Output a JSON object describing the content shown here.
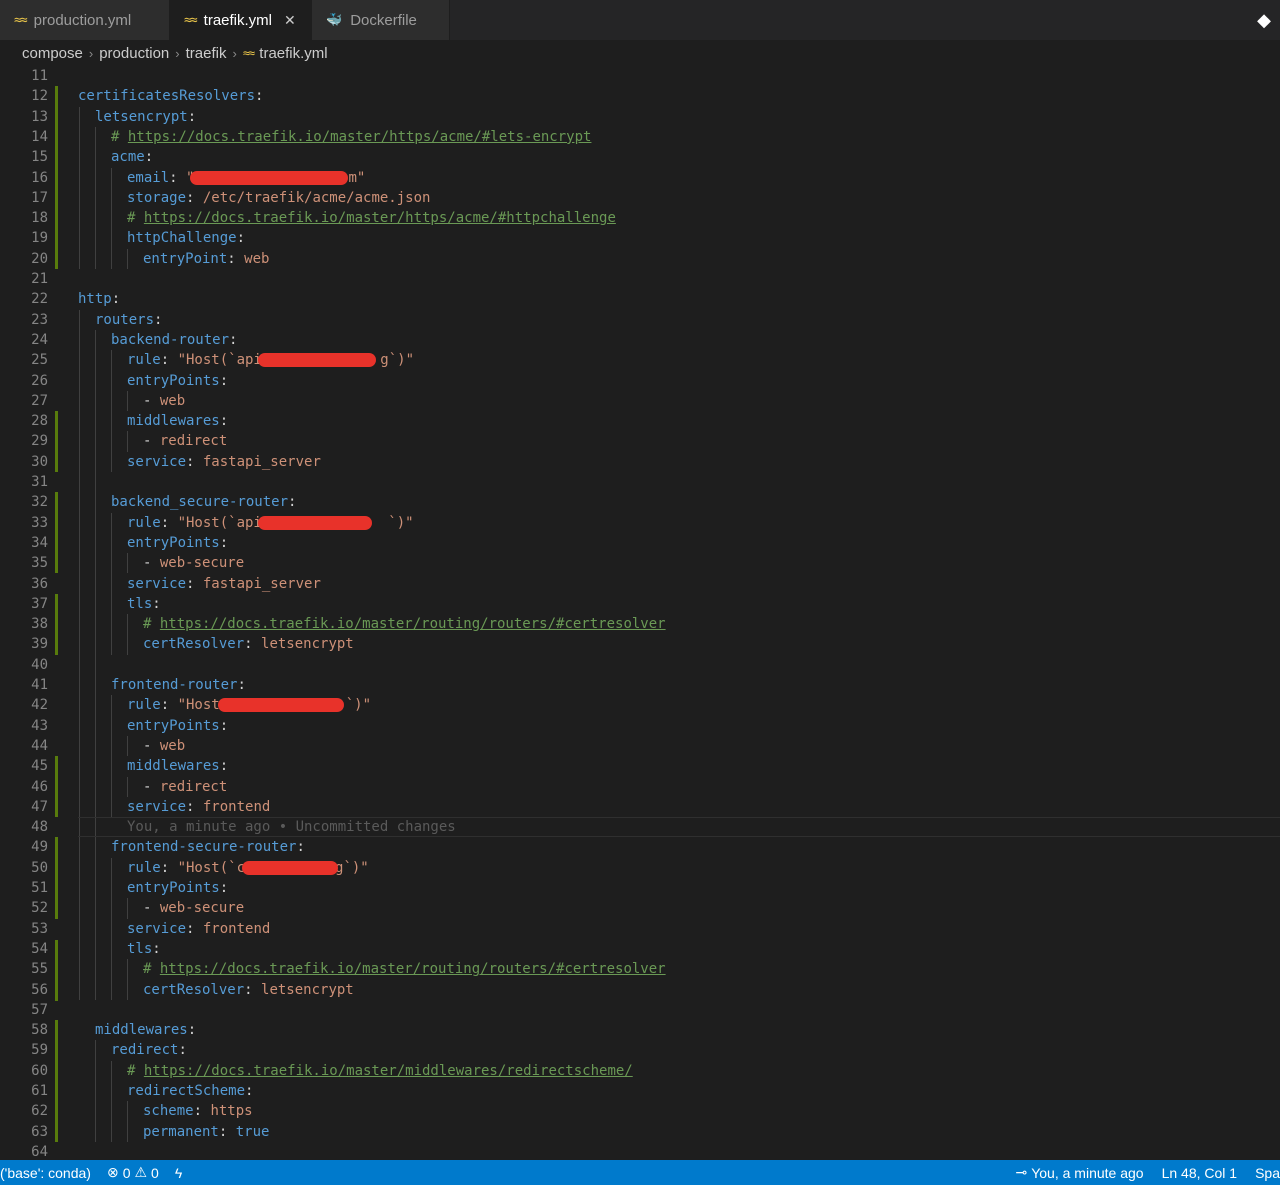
{
  "tabs": [
    {
      "label": "production.yml",
      "icon": "yaml-icon",
      "active": false
    },
    {
      "label": "traefik.yml",
      "icon": "yaml-icon",
      "active": true
    },
    {
      "label": "Dockerfile",
      "icon": "docker-icon",
      "active": false
    }
  ],
  "breadcrumb": [
    "compose",
    "production",
    "traefik",
    "traefik.yml"
  ],
  "editor": {
    "line_numbers": [
      "11",
      "12",
      "13",
      "14",
      "15",
      "16",
      "17",
      "18",
      "19",
      "20",
      "21",
      "22",
      "23",
      "24",
      "25",
      "26",
      "27",
      "28",
      "29",
      "30",
      "31",
      "32",
      "33",
      "34",
      "35",
      "36",
      "37",
      "38",
      "39",
      "40",
      "41",
      "42",
      "43",
      "44",
      "45",
      "46",
      "47",
      "48",
      "49",
      "50",
      "51",
      "52",
      "53",
      "54",
      "55",
      "56",
      "57",
      "58",
      "59",
      "60",
      "61",
      "62",
      "63",
      "64"
    ],
    "lines": {
      "l12": {
        "key": "certificatesResolvers",
        "punct": ":"
      },
      "l13": {
        "key": "letsencrypt",
        "punct": ":"
      },
      "l14": {
        "hash": "# ",
        "url": "https://docs.traefik.io/master/https/acme/#lets-encrypt"
      },
      "l15": {
        "key": "acme",
        "punct": ":"
      },
      "l16": {
        "key": "email",
        "punct": ": ",
        "val_start": "\"",
        "val_end": "m\""
      },
      "l17": {
        "key": "storage",
        "punct": ": ",
        "val": "/etc/traefik/acme/acme.json"
      },
      "l18": {
        "hash": "# ",
        "url": "https://docs.traefik.io/master/https/acme/#httpchallenge"
      },
      "l19": {
        "key": "httpChallenge",
        "punct": ":"
      },
      "l20": {
        "key": "entryPoint",
        "punct": ": ",
        "val": "web"
      },
      "l22": {
        "key": "http",
        "punct": ":"
      },
      "l23": {
        "key": "routers",
        "punct": ":"
      },
      "l24": {
        "key": "backend-router",
        "punct": ":"
      },
      "l25": {
        "key": "rule",
        "punct": ": ",
        "val_start": "\"Host(`api.",
        "val_end": "g`)\""
      },
      "l26": {
        "key": "entryPoints",
        "punct": ":"
      },
      "l27": {
        "dash": "- ",
        "val": "web"
      },
      "l28": {
        "key": "middlewares",
        "punct": ":"
      },
      "l29": {
        "dash": "- ",
        "val": "redirect"
      },
      "l30": {
        "key": "service",
        "punct": ": ",
        "val": "fastapi_server"
      },
      "l32": {
        "key": "backend_secure-router",
        "punct": ":"
      },
      "l33": {
        "key": "rule",
        "punct": ": ",
        "val_start": "\"Host(`api.",
        "val_end": "`)\""
      },
      "l34": {
        "key": "entryPoints",
        "punct": ":"
      },
      "l35": {
        "dash": "- ",
        "val": "web-secure"
      },
      "l36": {
        "key": "service",
        "punct": ": ",
        "val": "fastapi_server"
      },
      "l37": {
        "key": "tls",
        "punct": ":"
      },
      "l38": {
        "hash": "# ",
        "url": "https://docs.traefik.io/master/routing/routers/#certresolver"
      },
      "l39": {
        "key": "certResolver",
        "punct": ": ",
        "val": "letsencrypt"
      },
      "l41": {
        "key": "frontend-router",
        "punct": ":"
      },
      "l42": {
        "key": "rule",
        "punct": ": ",
        "val_start": "\"Host",
        "val_end": "`)\""
      },
      "l43": {
        "key": "entryPoints",
        "punct": ":"
      },
      "l44": {
        "dash": "- ",
        "val": "web"
      },
      "l45": {
        "key": "middlewares",
        "punct": ":"
      },
      "l46": {
        "dash": "- ",
        "val": "redirect"
      },
      "l47": {
        "key": "service",
        "punct": ": ",
        "val": "frontend"
      },
      "l48": {
        "blame": "You, a minute ago • Uncommitted changes"
      },
      "l49": {
        "key": "frontend-secure-router",
        "punct": ":"
      },
      "l50": {
        "key": "rule",
        "punct": ": ",
        "val_start": "\"Host(`c",
        "val_end": "g`)\""
      },
      "l51": {
        "key": "entryPoints",
        "punct": ":"
      },
      "l52": {
        "dash": "- ",
        "val": "web-secure"
      },
      "l53": {
        "key": "service",
        "punct": ": ",
        "val": "frontend"
      },
      "l54": {
        "key": "tls",
        "punct": ":"
      },
      "l55": {
        "hash": "# ",
        "url": "https://docs.traefik.io/master/routing/routers/#certresolver"
      },
      "l56": {
        "key": "certResolver",
        "punct": ": ",
        "val": "letsencrypt"
      },
      "l58": {
        "key": "middlewares",
        "punct": ":"
      },
      "l59": {
        "key": "redirect",
        "punct": ":"
      },
      "l60": {
        "hash": "# ",
        "url": "https://docs.traefik.io/master/middlewares/redirectscheme/"
      },
      "l61": {
        "key": "redirectScheme",
        "punct": ":"
      },
      "l62": {
        "key": "scheme",
        "punct": ": ",
        "val": "https"
      },
      "l63": {
        "key": "permanent",
        "punct": ": ",
        "val": "true"
      }
    }
  },
  "statusbar": {
    "env": "('base': conda)",
    "errors": "0",
    "warnings": "0",
    "blame": "You, a minute ago",
    "position": "Ln 48, Col 1",
    "spaces": "Spa"
  },
  "colors": {
    "accent": "#007acc",
    "key": "#569cd6",
    "string": "#ce9178",
    "comment": "#6a9955",
    "gutter_modified": "#587c0c",
    "redaction": "#e8322a"
  }
}
